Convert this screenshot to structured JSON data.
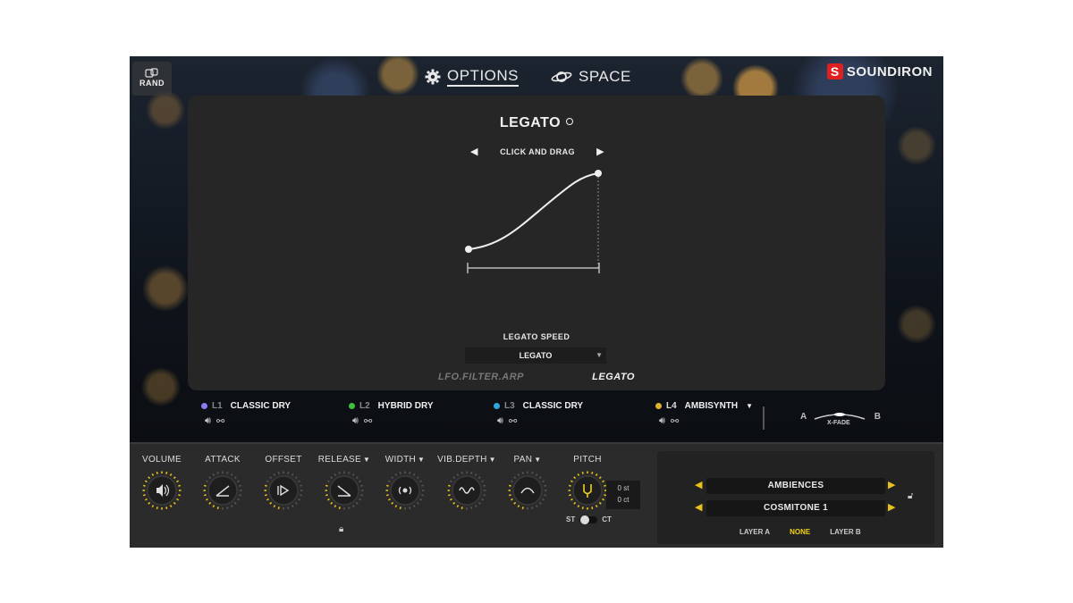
{
  "header": {
    "rand_label": "RAND",
    "nav": [
      {
        "label": "OPTIONS",
        "icon": "gear-icon",
        "active": true
      },
      {
        "label": "SPACE",
        "icon": "planet-icon",
        "active": false
      }
    ],
    "brand": "SOUNDIRON"
  },
  "panel": {
    "title": "LEGATO",
    "hint": "CLICK AND DRAG",
    "speed_label": "LEGATO SPEED",
    "speed_value": "LEGATO",
    "tabs": [
      {
        "label": "LFO.FILTER.ARP",
        "active": false
      },
      {
        "label": "LEGATO",
        "active": true
      }
    ]
  },
  "layers": [
    {
      "id": "L1",
      "name": "CLASSIC DRY",
      "color": "#8a7cf0",
      "has_menu": false
    },
    {
      "id": "L2",
      "name": "HYBRID DRY",
      "color": "#3fbf3f",
      "has_menu": false
    },
    {
      "id": "L3",
      "name": "CLASSIC DRY",
      "color": "#2fa6e0",
      "has_menu": false
    },
    {
      "id": "L4",
      "name": "AMBISYNTH",
      "color": "#e0b12f",
      "has_menu": true
    }
  ],
  "xfade": {
    "a": "A",
    "b": "B",
    "label": "X-FADE"
  },
  "knobs": [
    {
      "label": "VOLUME",
      "menu": false
    },
    {
      "label": "ATTACK",
      "menu": false
    },
    {
      "label": "OFFSET",
      "menu": false
    },
    {
      "label": "RELEASE",
      "menu": true
    },
    {
      "label": "WIDTH",
      "menu": true
    },
    {
      "label": "VIB.DEPTH",
      "menu": true
    },
    {
      "label": "PAN",
      "menu": true
    },
    {
      "label": "PITCH",
      "menu": false
    }
  ],
  "pitch": {
    "st": "0 st",
    "ct": "0 ct",
    "toggle_left": "ST",
    "toggle_right": "CT"
  },
  "presets": {
    "category": "AMBIENCES",
    "preset": "COSMITONE 1",
    "targets": [
      {
        "label": "LAYER A",
        "active": false
      },
      {
        "label": "NONE",
        "active": true
      },
      {
        "label": "LAYER B",
        "active": false
      }
    ]
  },
  "colors": {
    "accent": "#f2d11a",
    "brand": "#e02020",
    "panel": "#262626"
  }
}
